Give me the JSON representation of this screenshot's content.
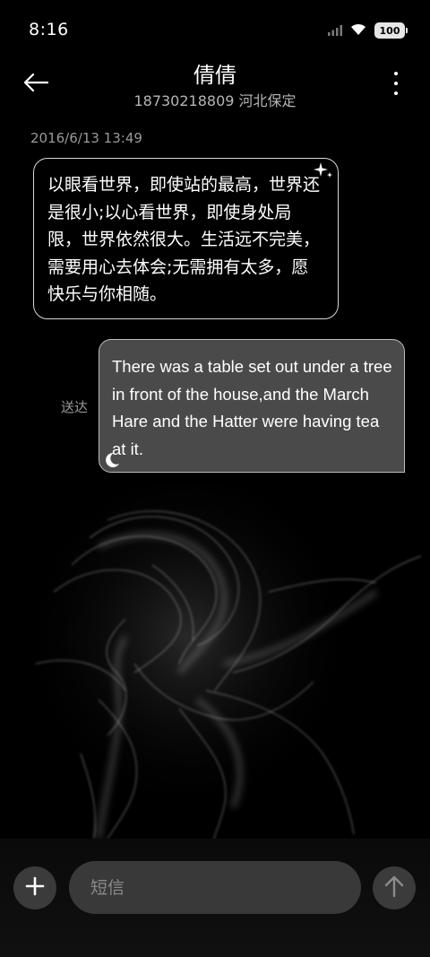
{
  "status_bar": {
    "time": "8:16",
    "battery": "100",
    "icons": [
      "signal-icon",
      "wifi-icon",
      "battery-icon"
    ]
  },
  "header": {
    "contact_name": "倩倩",
    "contact_detail": "18730218809 河北保定",
    "back_icon": "back-arrow-icon",
    "more_icon": "more-vertical-icon"
  },
  "conversation": {
    "timestamp": "2016/6/13 13:49",
    "incoming": {
      "text": "以眼看世界，即使站的最高，世界还是很小;以心看世界，即使身处局限，世界依然很大。生活远不完美，需要用心去体会;无需拥有太多，愿快乐与你相随。",
      "badge_icon": "sparkle-icon"
    },
    "outgoing": {
      "status": "送达",
      "text": "There was a table set out under a tree in front of the house,and the March Hare and the Hatter were having tea at it.",
      "badge_icon": "moon-icon"
    }
  },
  "composer": {
    "placeholder": "短信",
    "add_icon": "plus-icon",
    "send_icon": "send-arrow-icon"
  },
  "colors": {
    "background": "#000000",
    "outgoing_bubble": "#4a4a4a",
    "composer": "#393939",
    "secondary_text": "#9a9a9a"
  }
}
